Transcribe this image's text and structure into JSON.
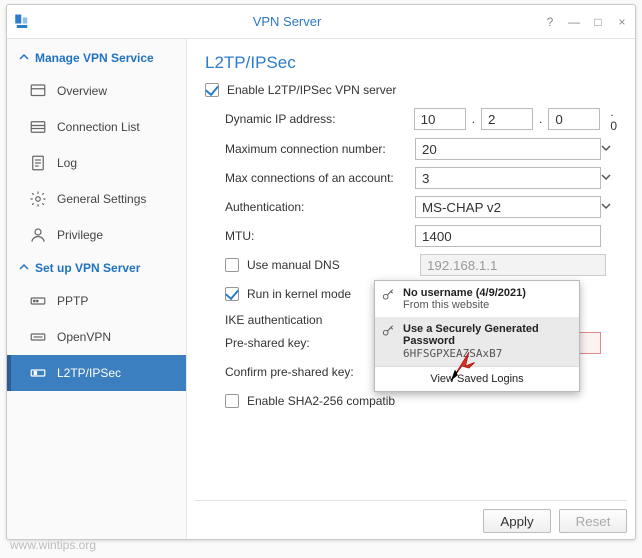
{
  "window": {
    "title": "VPN Server"
  },
  "sidebar": {
    "sections": [
      {
        "label": "Manage VPN Service",
        "items": [
          {
            "label": "Overview",
            "key": "overview"
          },
          {
            "label": "Connection List",
            "key": "connlist"
          },
          {
            "label": "Log",
            "key": "log"
          },
          {
            "label": "General Settings",
            "key": "gen"
          },
          {
            "label": "Privilege",
            "key": "priv"
          }
        ]
      },
      {
        "label": "Set up VPN Server",
        "items": [
          {
            "label": "PPTP",
            "key": "pptp"
          },
          {
            "label": "OpenVPN",
            "key": "openvpn"
          },
          {
            "label": "L2TP/IPSec",
            "key": "l2tp",
            "active": true
          }
        ]
      }
    ]
  },
  "page": {
    "title": "L2TP/IPSec",
    "enable_label": "Enable L2TP/IPSec VPN server",
    "dynamic_ip_label": "Dynamic IP address:",
    "dynamic_ip": {
      "o1": "10",
      "o2": "2",
      "o3": "0",
      "suffix": ". 0"
    },
    "max_conn_label": "Maximum connection number:",
    "max_conn": "20",
    "max_acct_label": "Max connections of an account:",
    "max_acct": "3",
    "auth_label": "Authentication:",
    "auth": "MS-CHAP v2",
    "mtu_label": "MTU:",
    "mtu": "1400",
    "manual_dns_label": "Use manual DNS",
    "manual_dns": "192.168.1.1",
    "kernel_label": "Run in kernel mode",
    "ike_label": "IKE authentication",
    "psk_label": "Pre-shared key:",
    "psk_confirm_label": "Confirm pre-shared key:",
    "sha_label": "Enable SHA2-256 compatib",
    "apply": "Apply",
    "reset": "Reset"
  },
  "popup": {
    "item1_title": "No username (4/9/2021)",
    "item1_sub": "From this website",
    "item2_title": "Use a Securely Generated Password",
    "item2_sub": "6HFSGPXEAZSAxB7",
    "footer": "View Saved Logins"
  },
  "watermark": "www.wintips.org"
}
